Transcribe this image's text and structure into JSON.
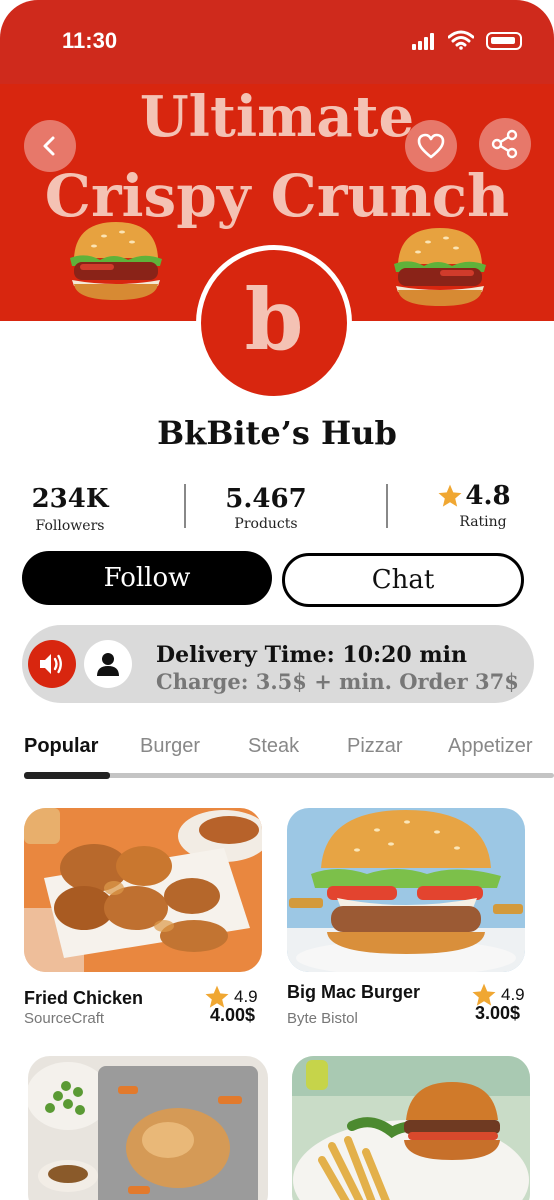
{
  "status_bar": {
    "time": "11:30"
  },
  "banner": {
    "line1": "Ultimate",
    "line2": "Crispy Crunch"
  },
  "logo": {
    "letter": "b"
  },
  "store": {
    "name": "BkBite’s Hub"
  },
  "stats": [
    {
      "value": "234K",
      "label": "Followers"
    },
    {
      "value": "5.467",
      "label": "Products"
    },
    {
      "value": "4.8",
      "label": "Rating"
    }
  ],
  "actions": {
    "follow_label": "Follow",
    "chat_label": "Chat"
  },
  "delivery": {
    "line1": "Delivery Time: 10:20 min",
    "line2": "Charge: 3.5$ + min. Order 37$"
  },
  "tabs": [
    "Popular",
    "Burger",
    "Steak",
    "Pizzar",
    "Appetizer"
  ],
  "products": [
    {
      "name": "Fried Chicken",
      "shop": "SourceCraft",
      "rating": "4.9",
      "price": "4.00$"
    },
    {
      "name": "Big Mac Burger",
      "shop": "Byte  Bistol",
      "rating": "4.9",
      "price": "3.00$"
    }
  ],
  "colors": {
    "brand": "#d8260f",
    "banner_text": "#f4c2b4",
    "star": "#f0a732"
  },
  "icons": [
    "back-icon",
    "heart-icon",
    "share-icon",
    "speaker-icon",
    "person-icon",
    "star-icon"
  ]
}
